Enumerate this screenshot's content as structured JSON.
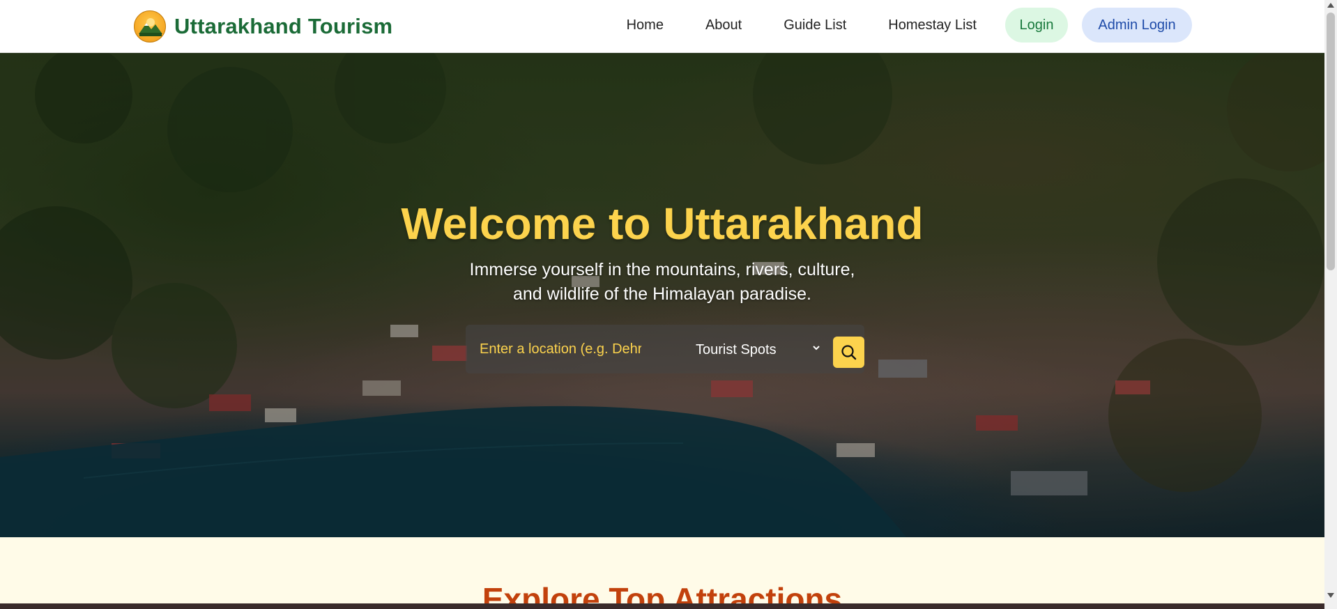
{
  "header": {
    "brand_name": "Uttarakhand Tourism",
    "logo_icon": "mountain-logo-icon",
    "nav": [
      {
        "label": "Home"
      },
      {
        "label": "About"
      },
      {
        "label": "Guide List"
      },
      {
        "label": "Homestay List"
      }
    ],
    "login_label": "Login",
    "admin_login_label": "Admin Login"
  },
  "hero": {
    "title": "Welcome to Uttarakhand",
    "subtitle_line1": "Immerse yourself in the mountains, rivers, culture,",
    "subtitle_line2": "and wildlife of the Himalayan paradise.",
    "search": {
      "placeholder": "Enter a location (e.g. Dehradun)",
      "visible_placeholder": "Enter a location (e.g. Dehr",
      "category_selected": "Tourist Spots",
      "search_icon": "search-icon"
    }
  },
  "section": {
    "title": "Explore Top Attractions"
  },
  "colors": {
    "brand_green": "#1b6b37",
    "accent_yellow": "#fcd34d",
    "section_title": "#c2410c",
    "section_bg": "#fffbe8"
  }
}
